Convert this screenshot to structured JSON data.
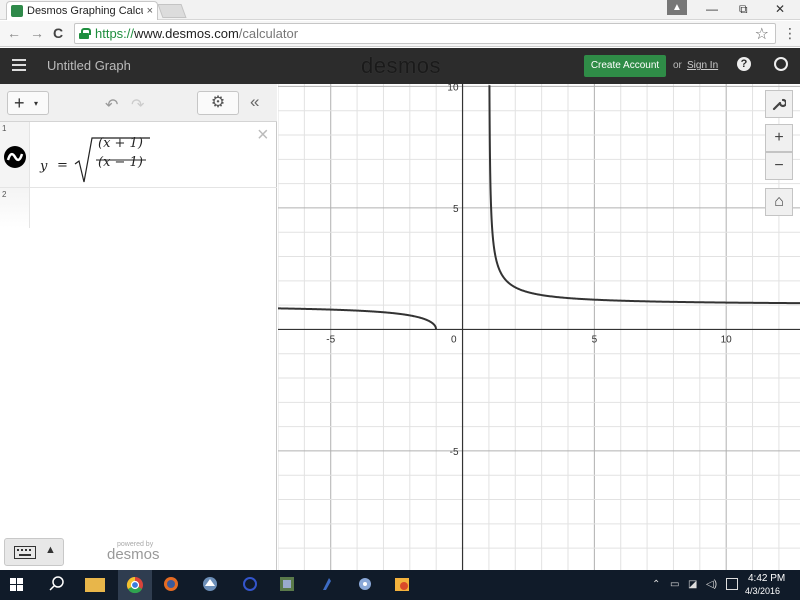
{
  "browser": {
    "tab_title": "Desmos Graphing Calculat",
    "tab_close": "×",
    "url_scheme": "https://",
    "url_host": "www.desmos.com",
    "url_path": "/calculator",
    "back_icon": "←",
    "forward_icon": "→",
    "reload_icon": "C",
    "star_icon": "☆",
    "menu_icon": "⋮",
    "win_minimize": "—",
    "win_restore": "⧉",
    "win_close": "✕",
    "profile_icon": "▲"
  },
  "header": {
    "graph_title": "Untitled Graph",
    "brand": "desmos",
    "create_account": "Create Account",
    "or": "or",
    "sign_in": "Sign In",
    "help": "?"
  },
  "toolbar": {
    "add_label": "+",
    "add_caret": "▾",
    "undo": "↶",
    "redo": "↷",
    "settings": "⚙",
    "collapse": "«"
  },
  "expressions": [
    {
      "index": "1",
      "lhs": "y",
      "eq": "=",
      "numerator": "(x + 1)",
      "denominator": "(x − 1)",
      "delete": "×"
    },
    {
      "index": "2"
    }
  ],
  "footer": {
    "powered_by": "powered by",
    "logo": "desmos"
  },
  "graph_controls": {
    "wrench": "🔧",
    "zoom_in": "+",
    "zoom_out": "−",
    "home": "⌂"
  },
  "chart_data": {
    "type": "line",
    "title": "",
    "xlabel": "",
    "ylabel": "",
    "xlim": [
      -7,
      12.8
    ],
    "ylim": [
      -9.9,
      10.1
    ],
    "x_ticks": [
      -5,
      0,
      5,
      10
    ],
    "x_tick_labels": [
      "-5",
      "0",
      "5",
      "10"
    ],
    "y_ticks": [
      10,
      5,
      -5
    ],
    "y_tick_labels": [
      "10",
      "5",
      "-5"
    ],
    "grid": true,
    "minor_grid_step": 1,
    "major_grid_step": 5,
    "series": [
      {
        "expression": "y = sqrt((x + 1)/(x − 1))",
        "color": "#333333",
        "x": [
          -7,
          -6,
          -5,
          -4,
          -3,
          -2,
          -1.5,
          -1.2,
          -1
        ],
        "y": [
          0.866,
          0.845,
          0.816,
          0.775,
          0.707,
          0.577,
          0.447,
          0.302,
          0
        ]
      },
      {
        "expression": "y = sqrt((x + 1)/(x − 1))",
        "color": "#333333",
        "x": [
          1.02,
          1.05,
          1.1,
          1.2,
          1.5,
          2,
          3,
          4,
          5,
          6,
          8,
          10,
          12.8
        ],
        "y": [
          9.95,
          6.4,
          4.58,
          3.32,
          2.24,
          1.73,
          1.41,
          1.29,
          1.22,
          1.18,
          1.13,
          1.11,
          1.09
        ]
      }
    ]
  },
  "taskbar": {
    "time": "4:42 PM",
    "date": "4/3/2016"
  }
}
